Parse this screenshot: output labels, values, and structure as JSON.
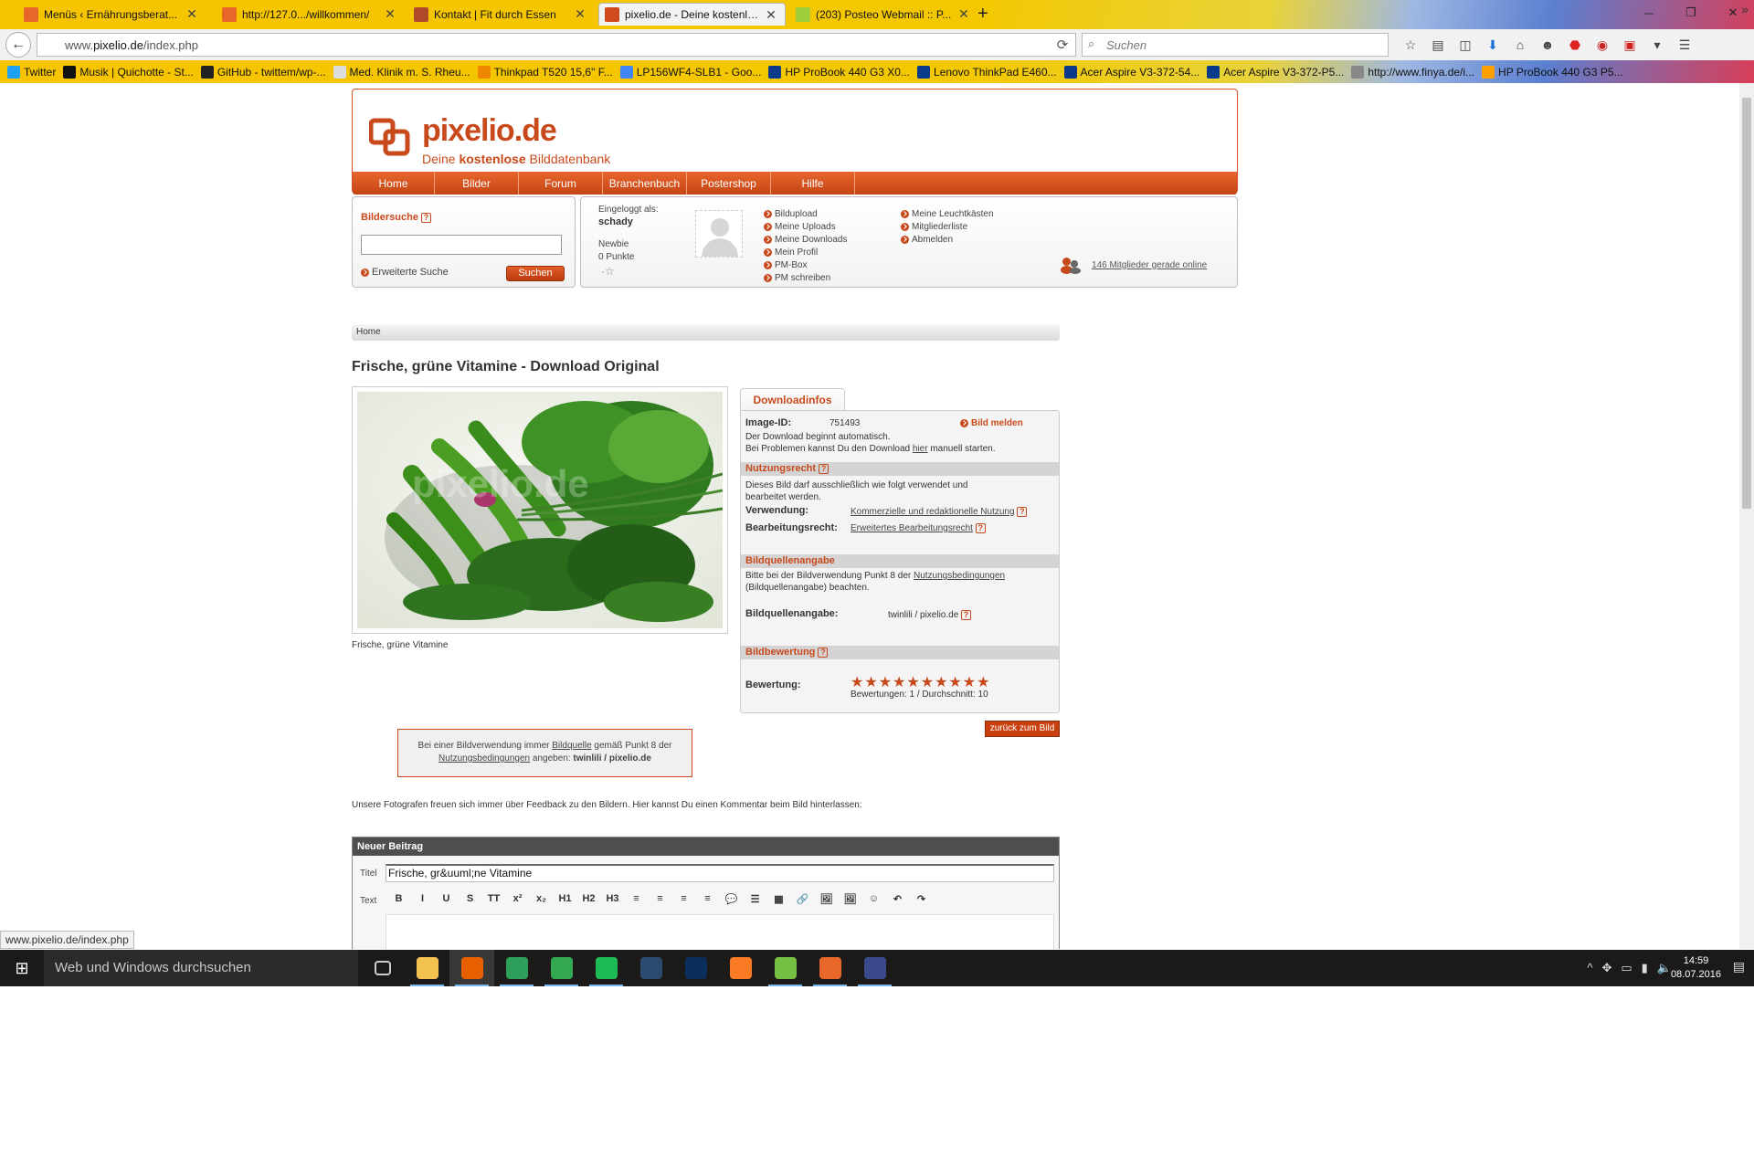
{
  "browser": {
    "tabs": [
      {
        "title": "Menüs ‹ Ernährungsberat...",
        "favicon_color": "#e8682c"
      },
      {
        "title": "http://127.0.../willkommen/",
        "favicon_color": "#e8682c"
      },
      {
        "title": "Kontakt | Fit durch Essen",
        "favicon_color": "#b04a2a"
      },
      {
        "title": "pixelio.de - Deine kostenlo...",
        "favicon_color": "#d04a1c"
      },
      {
        "title": "(203) Posteo Webmail :: P...",
        "favicon_color": "#9fcf3a"
      }
    ],
    "active_tab": 3,
    "url_prefix": "www.",
    "url_domain": "pixelio.de",
    "url_path": "/index.php",
    "search_placeholder": "Suchen",
    "bookmarks": [
      {
        "label": "Twitter",
        "color": "#1da1f2"
      },
      {
        "label": "Musik | Quichotte - St...",
        "color": "#111111"
      },
      {
        "label": "GitHub - twittem/wp-...",
        "color": "#222222"
      },
      {
        "label": "Med. Klinik m. S. Rheu...",
        "color": "#dddddd"
      },
      {
        "label": "Thinkpad T520 15,6\" F...",
        "color": "#ee8800"
      },
      {
        "label": "LP156WF4-SLB1 - Goo...",
        "color": "#4285f4"
      },
      {
        "label": "HP ProBook 440 G3 X0...",
        "color": "#0a3a8a"
      },
      {
        "label": "Lenovo ThinkPad E460...",
        "color": "#0a3a8a"
      },
      {
        "label": "Acer Aspire V3-372-54...",
        "color": "#0a3a8a"
      },
      {
        "label": "Acer Aspire V3-372-P5...",
        "color": "#0a3a8a"
      },
      {
        "label": "http://www.finya.de/i...",
        "color": "#888888"
      },
      {
        "label": "HP ProBook 440 G3 P5...",
        "color": "#ffa000"
      }
    ],
    "status_url": "www.pixelio.de/index.php"
  },
  "site": {
    "logo_name": "pixelio.de",
    "logo_tag_a": "Deine ",
    "logo_tag_b": "kostenlose",
    "logo_tag_c": " Bilddatenbank",
    "nav": [
      "Home",
      "Bilder",
      "Forum",
      "Branchenbuch",
      "Postershop",
      "Hilfe"
    ],
    "search": {
      "heading": "Bildersuche",
      "advanced": "Erweiterte Suche",
      "button": "Suchen"
    },
    "user": {
      "logged_in_label": "Eingeloggt als:",
      "username": "schady",
      "rank": "Newbie",
      "points": "0 Punkte",
      "links_left": [
        "Bildupload",
        "Meine Uploads",
        "Meine Downloads",
        "Mein Profil",
        "PM-Box",
        "PM schreiben"
      ],
      "links_right": [
        "Meine Leuchtkästen",
        "Mitgliederliste",
        "Abmelden"
      ],
      "online": "146 Mitglieder gerade online"
    },
    "breadcrumb": "Home",
    "page_title": "Frische, grüne Vitamine - Download Original",
    "image_caption": "Frische, grüne Vitamine",
    "watermark": "pixelio.de",
    "download": {
      "tab": "Downloadinfos",
      "image_id_label": "Image-ID:",
      "image_id": "751493",
      "report": "Bild melden",
      "auto1": "Der Download beginnt automatisch.",
      "auto2a": "Bei Problemen kannst Du den Download ",
      "auto2b": "hier",
      "auto2c": " manuell starten.",
      "usage_heading": "Nutzungsrecht",
      "usage_text1": "Dieses Bild darf ausschließlich wie folgt verwendet und",
      "usage_text2": "bearbeitet werden.",
      "verwendung_label": "Verwendung:",
      "verwendung_value": "Kommerzielle und redaktionelle Nutzung",
      "bearbeitung_label": "Bearbeitungsrecht:",
      "bearbeitung_value": "Erweitertes Bearbeitungsrecht",
      "source_heading": "Bildquellenangabe",
      "source_text1a": "Bitte bei der Bildverwendung Punkt 8 der ",
      "source_text1b": "Nutzungsbedingungen",
      "source_text2": "(Bildquellenangabe) beachten.",
      "source_label": "Bildquellenangabe:",
      "source_value": "twinlili  / pixelio.de",
      "rating_heading": "Bildbewertung",
      "rating_label": "Bewertung:",
      "rating_stars": 10,
      "rating_summary": "Bewertungen: 1 / Durchschnitt: 10",
      "back_button": "zurück zum Bild"
    },
    "notice": {
      "a": "Bei einer Bildverwendung immer ",
      "b": "Bildquelle",
      "c": " gemäß Punkt 8 der",
      "d": "Nutzungsbedingungen",
      "e": " angeben: ",
      "f": "twinlili  / pixelio.de"
    },
    "feedback": "Unsere Fotografen freuen sich immer über Feedback zu den Bildern. Hier kannst Du einen Kommentar beim Bild hinterlassen:",
    "new_post": {
      "heading": "Neuer Beitrag",
      "title_label": "Titel",
      "title_value": "Frische, gr&uuml;ne Vitamine",
      "text_label": "Text",
      "toolbar": [
        "B",
        "I",
        "U",
        "S",
        "TT",
        "x²",
        "x₂",
        "H1",
        "H2",
        "H3",
        "≡",
        "≡",
        "≡",
        "≡",
        "💬",
        "☰",
        "▦",
        "🔗",
        "🖼",
        "🖼",
        "☺",
        "↶",
        "↷"
      ]
    }
  },
  "taskbar": {
    "search": "Web und Windows durchsuchen",
    "time": "14:59",
    "date": "08.07.2016",
    "apps": [
      {
        "name": "task-view",
        "color": "#1c1a18"
      },
      {
        "name": "file-explorer",
        "color": "#f2c14e"
      },
      {
        "name": "firefox",
        "color": "#e66000"
      },
      {
        "name": "app-green",
        "color": "#2e9e5b"
      },
      {
        "name": "chrome",
        "color": "#34a853"
      },
      {
        "name": "spotify",
        "color": "#1db954"
      },
      {
        "name": "lightroom",
        "color": "#2a4b6e"
      },
      {
        "name": "photoshop",
        "color": "#0a2f5a"
      },
      {
        "name": "xampp",
        "color": "#fb7a24"
      },
      {
        "name": "utorrent",
        "color": "#74c043"
      },
      {
        "name": "app-orange",
        "color": "#e8682c"
      },
      {
        "name": "keepass",
        "color": "#3a4a8a"
      }
    ]
  }
}
